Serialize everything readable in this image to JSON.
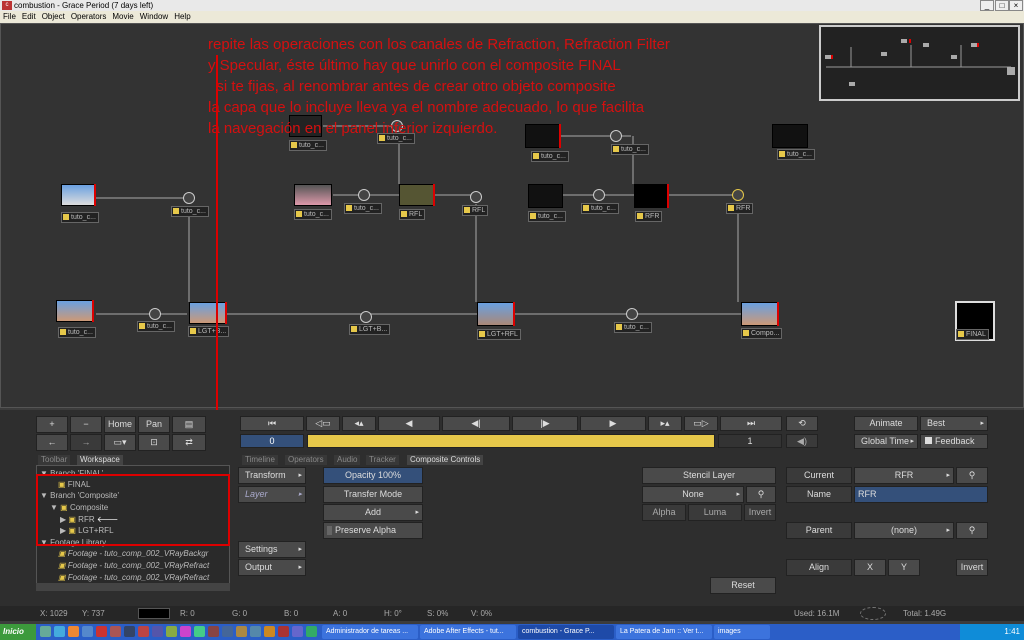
{
  "window": {
    "title": "combustion - Grace Period (7 days left)"
  },
  "menu": [
    "File",
    "Edit",
    "Object",
    "Operators",
    "Movie",
    "Window",
    "Help"
  ],
  "annotation": {
    "lines": [
      "repite las operaciones con los canales de Refraction, Refraction Filter",
      "y Specular, éste último hay que unirlo con el composite FINAL",
      "  si te fijas, al renombrar antes de crear otro objeto composite",
      "la capa que lo incluye lleva ya el nombre adecuado, lo que facilita",
      "la navegación en el panel inferior izquierdo."
    ],
    "color": "#d41010"
  },
  "nodes": [
    {
      "label": "tuto_c...",
      "thumb": "#9ab"
    },
    {
      "label": "tuto_c...",
      "thumb": "#222"
    },
    {
      "label": "tuto_c...",
      "thumb": "#c88"
    },
    {
      "label": "tuto_c...",
      "thumb": "#111"
    },
    {
      "label": "tuto_c...",
      "thumb": "#d9a"
    },
    {
      "label": "RFL",
      "thumb": "#553"
    },
    {
      "label": "tuto_c...",
      "thumb": "#111"
    },
    {
      "label": "RFR",
      "thumb": "#000"
    },
    {
      "label": "tuto_c...",
      "thumb": "#c97"
    },
    {
      "label": "LGT+B...",
      "thumb": "#c97"
    },
    {
      "label": "LGT+RFL",
      "thumb": "#a87"
    },
    {
      "label": "Compo...",
      "thumb": "#c97"
    },
    {
      "label": "FINAL",
      "thumb": "#000"
    },
    {
      "label": "tuto_c...",
      "thumb": "#111"
    }
  ],
  "pipes": [
    "tuto_c...",
    "tuto_c...",
    "tuto_c...",
    "RFL",
    "tuto_c...",
    "RFR",
    "tuto_c...",
    "LGT+B...",
    "LGT+RFL",
    "tuto_c..."
  ],
  "view_buttons": {
    "home": "Home",
    "pan": "Pan"
  },
  "transport": {
    "frame_start": "0",
    "frame_end": "1"
  },
  "right_top": {
    "animate": "Animate",
    "best": "Best",
    "global_time": "Global Time",
    "feedback": "Feedback"
  },
  "left_tabs": [
    "Toolbar",
    "Workspace"
  ],
  "tree": [
    {
      "text": "Branch 'FINAL'",
      "level": 0
    },
    {
      "text": "FINAL",
      "level": 1
    },
    {
      "text": "Branch 'Composite'",
      "level": 0
    },
    {
      "text": "Composite",
      "level": 1
    },
    {
      "text": "RFR",
      "level": 2
    },
    {
      "text": "LGT+RFL",
      "level": 2
    },
    {
      "text": "Footage Library",
      "level": 0
    },
    {
      "text": "Footage - tuto_comp_002_VRayBackgr",
      "level": 1
    },
    {
      "text": "Footage - tuto_comp_002_VRayRefract",
      "level": 1
    },
    {
      "text": "Footage - tuto_comp_002_VRayRefract",
      "level": 1
    }
  ],
  "mid_tabs": [
    "Timeline",
    "Operators",
    "Audio",
    "Tracker",
    "Composite Controls"
  ],
  "side_buttons": {
    "transform": "Transform",
    "layer": "Layer",
    "settings": "Settings",
    "output": "Output"
  },
  "composite": {
    "opacity": "Opacity 100%",
    "transfer_mode": "Transfer Mode",
    "add": "Add",
    "preserve_alpha": "Preserve Alpha"
  },
  "stencil": {
    "title": "Stencil Layer",
    "none": "None",
    "alpha": "Alpha",
    "luma": "Luma",
    "invert": "Invert"
  },
  "props": {
    "current_label": "Current",
    "current_value": "RFR",
    "name_label": "Name",
    "name_value": "RFR",
    "parent_label": "Parent",
    "parent_value": "(none)",
    "align_label": "Align",
    "x": "X",
    "y": "Y",
    "invert": "Invert",
    "reset": "Reset"
  },
  "status": {
    "x": "X: 1029",
    "y": "Y: 737",
    "r": "R: 0",
    "g": "G: 0",
    "b": "B: 0",
    "a": "A: 0",
    "h": "H: 0°",
    "s": "S: 0%",
    "v": "V: 0%",
    "used": "Used: 16.1M",
    "total": "Total: 1.49G"
  },
  "taskbar": {
    "start": "Inicio",
    "tasks": [
      "Administrador de tareas ...",
      "Adobe After Effects - tut...",
      "combustion - Grace P...",
      "La Patera de Jam :: Ver t...",
      "images"
    ],
    "clock": "1:41"
  }
}
